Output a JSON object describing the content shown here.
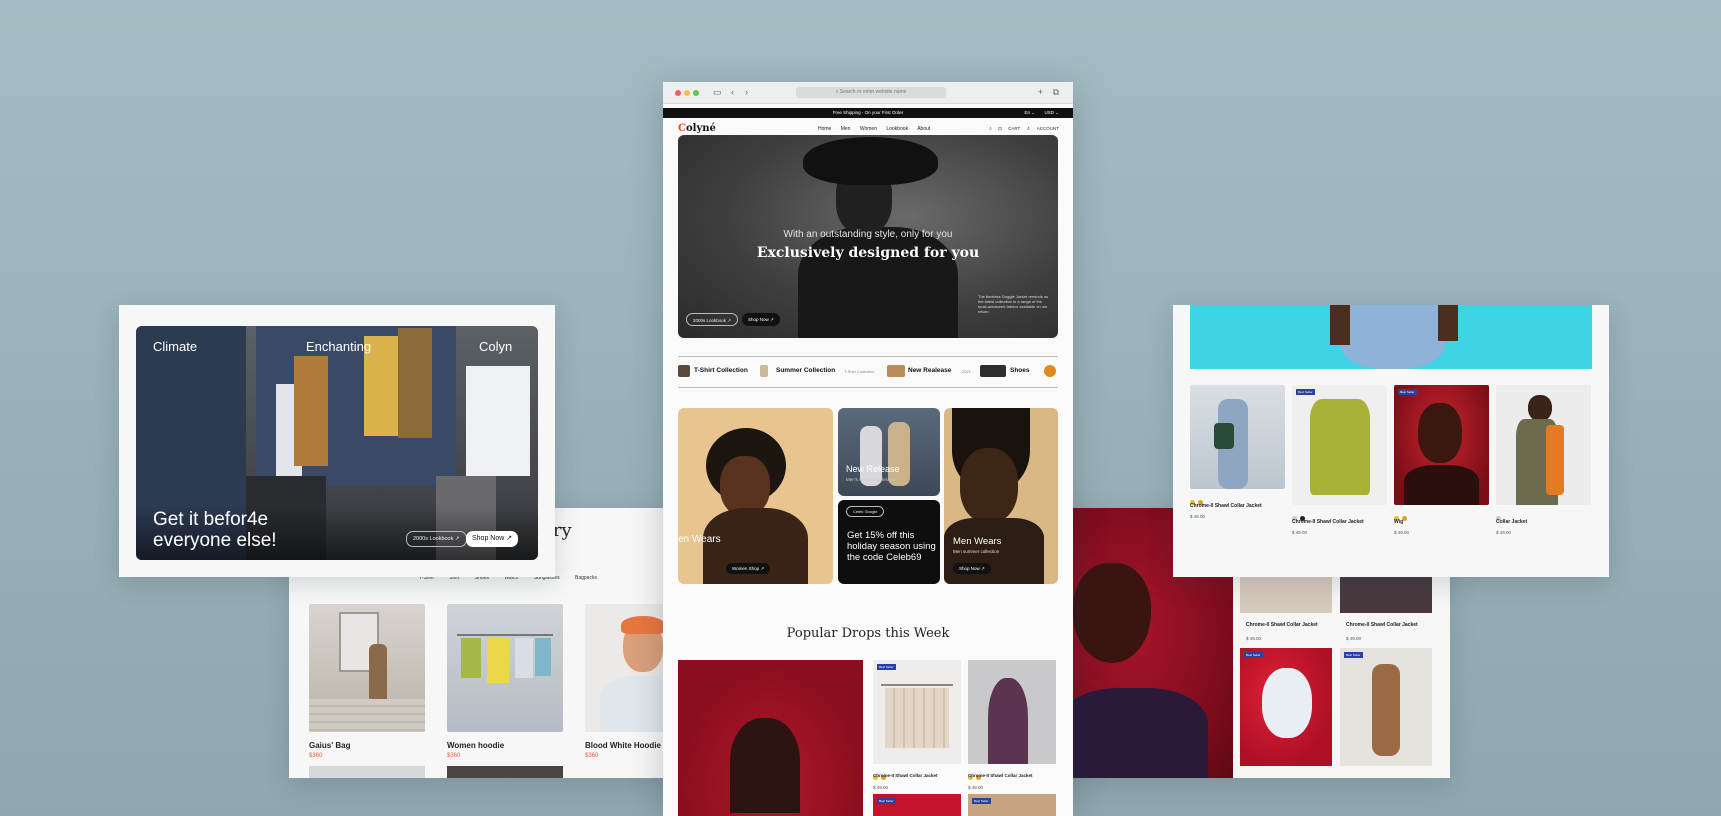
{
  "browser": {
    "address_placeholder": "Search or enter website name",
    "promo_bar": "Free Shipping - On your First Order",
    "language": "En",
    "currency": "USD"
  },
  "site": {
    "logo_mark": "C",
    "logo_rest": "olyné",
    "nav": [
      "Home",
      "Men",
      "Women",
      "Lookbook",
      "About"
    ],
    "cart": "CART",
    "account": "ACCOUNT"
  },
  "hero": {
    "subtitle": "With an outstanding style, only for you",
    "title": "Exclusively designed for you",
    "description": "The timeless Goggle Jacket reminds us the latest collection in a range of the most-advanced fabrics available on our return.",
    "lookbook_button": "2000s Lookbook",
    "shop_button": "Shop Now"
  },
  "collections": [
    {
      "label": "T-Shirt Collection",
      "note": ""
    },
    {
      "label": "Summer Collection",
      "note": "T-Shirt Collection"
    },
    {
      "label": "New Realease",
      "note": "2021"
    },
    {
      "label": "Shoes",
      "note": ""
    }
  ],
  "promo_tiles": {
    "women_label": "en Wears",
    "women_button": "Women Shop",
    "new_release_title": "New Release",
    "new_release_sub": "Men's summer collection",
    "code_chip": "Celeb Google",
    "code_text": "Get 15% off this holiday season using the code Celeb69",
    "men_title": "Men Wears",
    "men_sub": "Men summer collection",
    "men_button": "Shop Now"
  },
  "popular_heading": "Popular Drops this Week",
  "popular_products": [
    {
      "name": "Chrome-II Shawl Collar Jacket",
      "price": "$ 49.00",
      "colors": [
        "#e0c030",
        "#d8a020"
      ]
    },
    {
      "name": "Chrome-II Shawl Collar Jacket",
      "price": "$ 49.00",
      "colors": [
        "#e0c030",
        "#d8a020"
      ]
    }
  ],
  "left_card": {
    "top_words": [
      "Climate",
      "Enchanting",
      "Colyn"
    ],
    "headline_line1": "Get it befor4e",
    "headline_line2": "everyone else!",
    "lookbook_button": "2000s Lookbook",
    "shop_button": "Shop Now"
  },
  "category_card": {
    "heading_fragment": "ory",
    "filters": [
      "T-Shirt",
      "Shirt",
      "Shoes",
      "Watch",
      "Sunglasses",
      "Bagpacks"
    ],
    "products": [
      {
        "name": "Gaius' Bag",
        "price": "$360"
      },
      {
        "name": "Women hoodie",
        "price": "$360"
      },
      {
        "name": "Blood White Hoodie",
        "price": "$360"
      }
    ]
  },
  "right_top_card": {
    "badge": "Best Seller",
    "products": [
      {
        "name": "Chrome-II Shawl Collar Jacket",
        "price": "$ 49.00",
        "colors": [
          "#e0c030",
          "#d8a020"
        ]
      },
      {
        "name": "Chrome-II Shawl Collar Jacket",
        "price": "$ 49.00",
        "colors": [
          "#c9c9c9",
          "#222222"
        ]
      },
      {
        "name": "Wig",
        "price": "$ 49.00",
        "colors": [
          "#e0c030",
          "#d8a020"
        ]
      },
      {
        "name": "Collar Jacket",
        "price": "$ 49.00",
        "colors": [
          "#c9c9c9"
        ]
      }
    ]
  },
  "right_bottom_card": {
    "badge": "Best Seller",
    "products": [
      {
        "name": "Chrome-II Shawl Collar Jacket",
        "price": "$ 49.00"
      },
      {
        "name": "Chrome-II Shawl Collar Jacket",
        "price": "$ 49.00"
      }
    ]
  }
}
